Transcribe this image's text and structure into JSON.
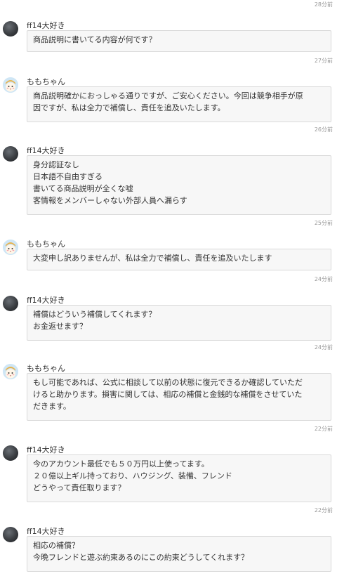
{
  "timestamps": [
    "28分前",
    "27分前",
    "26分前",
    "25分前",
    "24分前",
    "24分前",
    "22分前",
    "22分前"
  ],
  "messages": [
    {
      "sender": "ff14大好き",
      "avatar": "dark-avatar",
      "lines": [
        "商品説明に書いてる内容が何です？"
      ]
    },
    {
      "sender": "ももちゃん",
      "avatar": "character-avatar",
      "lines": [
        "商品説明確かにおっしゃる通りですが、ご安心ください。今回は競争相手が原",
        "因ですが、私は全力で補償し、責任を追及いたします。"
      ]
    },
    {
      "sender": "ff14大好き",
      "avatar": "dark-avatar",
      "lines": [
        "身分認証なし",
        "日本語不自由すぎる",
        "書いてる商品説明が全くな嘘",
        "客情報をメンバーしゃない外部人員へ漏らす"
      ]
    },
    {
      "sender": "ももちゃん",
      "avatar": "character-avatar",
      "lines": [
        "大変申し訳ありませんが、私は全力で補償し、責任を追及いたします"
      ]
    },
    {
      "sender": "ff14大好き",
      "avatar": "dark-avatar",
      "lines": [
        "補償はどういう補償してくれます？",
        "お金返せます？"
      ]
    },
    {
      "sender": "ももちゃん",
      "avatar": "character-avatar",
      "lines": [
        "もし可能であれば、公式に相談して以前の状態に復元できるか確認していただ",
        "けると助かります。損害に関しては、相応の補償と金銭的な補償をさせていた",
        "だきます。"
      ]
    },
    {
      "sender": "ff14大好き",
      "avatar": "dark-avatar",
      "lines": [
        "今のアカウント最低でも５０万円以上使ってます。",
        "２０億以上ギル持っており、ハウジング、装備、フレンド",
        "どうやって責任取ります？"
      ]
    },
    {
      "sender": "ff14大好き",
      "avatar": "dark-avatar",
      "lines": [
        "相応の補償？",
        "今晩フレンドと遊ぶ約束あるのにこの約束どうしてくれます？"
      ]
    }
  ]
}
